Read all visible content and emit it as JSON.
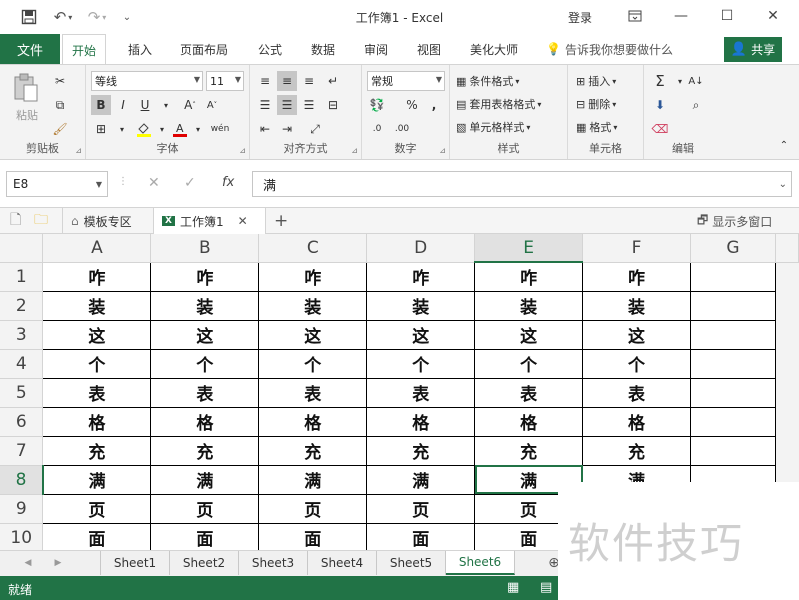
{
  "title": "工作簿1  -  Excel",
  "login": "登录",
  "tabs": {
    "file": "文件",
    "items": [
      "开始",
      "插入",
      "页面布局",
      "公式",
      "数据",
      "审阅",
      "视图",
      "美化大师"
    ],
    "tell_me": "告诉我你想要做什么",
    "share": "共享"
  },
  "ribbon": {
    "clipboard": {
      "label": "剪贴板",
      "paste": "粘贴"
    },
    "font": {
      "label": "字体",
      "font_name": "等线",
      "font_size": "11",
      "bold": "B",
      "italic": "I",
      "underline": "U"
    },
    "alignment": {
      "label": "对齐方式"
    },
    "number": {
      "label": "数字",
      "format": "常规"
    },
    "styles": {
      "label": "样式",
      "conditional": "条件格式",
      "table": "套用表格格式",
      "cell": "单元格样式"
    },
    "cells": {
      "label": "单元格",
      "insert": "插入",
      "delete": "删除",
      "format": "格式"
    },
    "editing": {
      "label": "编辑"
    }
  },
  "formula_bar": {
    "name_box": "E8",
    "fx": "fx",
    "content": "满"
  },
  "doc_tabs": {
    "template": "模板专区",
    "workbook": "工作簿1",
    "show_multi": "显示多窗口"
  },
  "grid": {
    "columns": [
      "A",
      "B",
      "C",
      "D",
      "E",
      "F",
      "G"
    ],
    "rows": [
      "1",
      "2",
      "3",
      "4",
      "5",
      "6",
      "7",
      "8",
      "9",
      "10"
    ],
    "cell_values": [
      "咋",
      "装",
      "这",
      "个",
      "表",
      "格",
      "充",
      "满",
      "页",
      "面"
    ],
    "selected_cell": "E8"
  },
  "sheets": [
    "Sheet1",
    "Sheet2",
    "Sheet3",
    "Sheet4",
    "Sheet5",
    "Sheet6"
  ],
  "active_sheet": "Sheet6",
  "status": "就绪",
  "watermark": "软件技巧",
  "colors": {
    "accent": "#217346"
  }
}
